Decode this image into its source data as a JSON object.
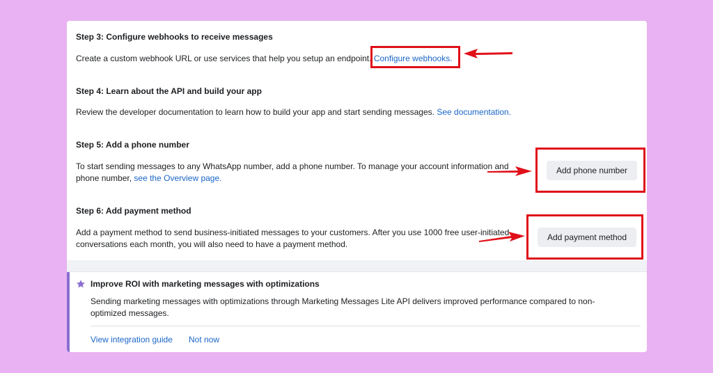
{
  "steps": {
    "s3": {
      "title": "Step 3: Configure webhooks to receive messages",
      "text": "Create a custom webhook URL or use services that help you setup an endpoint.",
      "link": "Configure webhooks."
    },
    "s4": {
      "title": "Step 4: Learn about the API and build your app",
      "text": "Review the developer documentation to learn how to build your app and start sending messages.",
      "link": "See documentation."
    },
    "s5": {
      "title": "Step 5: Add a phone number",
      "text1": "To start sending messages to any WhatsApp number, add a phone number. To manage your account information and",
      "text2": "phone number,",
      "link": "see the Overview page.",
      "button": "Add phone number"
    },
    "s6": {
      "title": "Step 6: Add payment method",
      "text1": "Add a payment method to send business-initiated messages to your customers. After you use 1000 free user-initiated",
      "text2": "conversations each month, you will also need to have a payment method.",
      "button": "Add payment method"
    }
  },
  "promo": {
    "icon": "star-icon",
    "title": "Improve ROI with marketing messages with optimizations",
    "text": "Sending marketing messages with optimizations through Marketing Messages Lite API delivers improved performance compared to non-optimized messages.",
    "actions": [
      "View integration guide",
      "Not now"
    ]
  },
  "colors": {
    "background": "#e9b2f2",
    "link": "#1a66c7",
    "highlight": "#e01019",
    "accent": "#8a6fd1"
  }
}
